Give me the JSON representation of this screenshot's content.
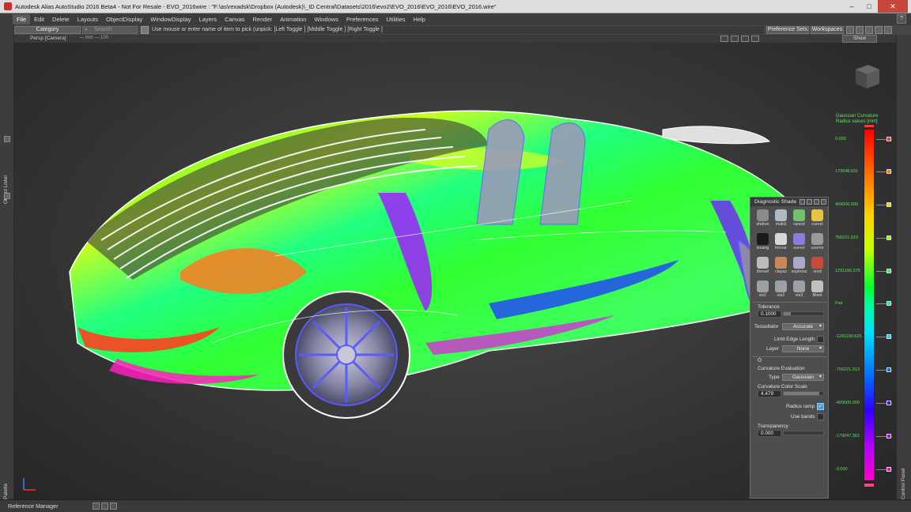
{
  "window": {
    "title": "Autodesk Alias AutoStudio 2016 Beta4 - Not For Resale  -  EVO_2016wire : \"F:\\as\\rexadsk\\Dropbox (Autodesk)\\_ID Central\\Datasets\\2016\\evo2\\EVO_2016\\EVO_2016\\EVO_2016.wire\"",
    "minimize": "–",
    "maximize": "□",
    "close": "✕"
  },
  "menu": [
    "File",
    "Edit",
    "Delete",
    "Layouts",
    "ObjectDisplay",
    "WindowDisplay",
    "Layers",
    "Canvas",
    "Render",
    "Animation",
    "Windows",
    "Preferences",
    "Utilities",
    "Help"
  ],
  "toolbar": {
    "category": "Category",
    "search_placeholder": "Search",
    "prompt": "Use mouse or enter name of item to pick (unpick: [Left Toggle ] [Middle Toggle ] [Right Toggle ]",
    "preference_sets": "Preference Sets",
    "workspaces": "Workspaces"
  },
  "viewport": {
    "camera": "Persp [Camera]",
    "ruler": "— mm  — 100",
    "show": "Show"
  },
  "left_rail": {
    "object_lister": "Object Lister",
    "palette": "Palette"
  },
  "right_rail": {
    "control_panel": "Control Panel"
  },
  "legend": {
    "title_line1": "Gaussian Curvature",
    "title_line2": "Radius values [mm]",
    "labels": [
      "0.000",
      "179048.831",
      "409000.000",
      "756221.013",
      "1291190.375",
      "Flat",
      "-1291190.625",
      "-756221.013",
      "-409000.000",
      "-179047.363",
      "-0.000"
    ]
  },
  "diag_panel": {
    "title": "Diagnostic Shade",
    "shaders": [
      {
        "label": "shdren",
        "color": "#8a8a8a"
      },
      {
        "label": "multcl",
        "color": "#b0b8c0"
      },
      {
        "label": "rancol",
        "color": "#6fc26a"
      },
      {
        "label": "curevl",
        "color": "#e2c640"
      },
      {
        "label": "isoang",
        "color": "#1a1a1a"
      },
      {
        "label": "horvar",
        "color": "#d8d8d8"
      },
      {
        "label": "surevl",
        "color": "#8a7de0"
      },
      {
        "label": "usemo",
        "color": "#9a9a9a"
      },
      {
        "label": "thinsel",
        "color": "#bcbcbc"
      },
      {
        "label": "clayaz",
        "color": "#c88858"
      },
      {
        "label": "sophoss",
        "color": "#a8a8c8"
      },
      {
        "label": "vred",
        "color": "#c84a3a"
      },
      {
        "label": "vis1",
        "color": "#9aa0a6"
      },
      {
        "label": "vis2",
        "color": "#9aa0a6"
      },
      {
        "label": "vis3",
        "color": "#9aa0a6"
      },
      {
        "label": "fillest",
        "color": "#c0c0c0"
      }
    ],
    "tolerance_label": "Tolerance",
    "tolerance_value": "0.1000",
    "tessellator_label": "Tessellator",
    "tessellator_value": "Accurate",
    "limit_edge_label": "Limit Edge Length",
    "layer_label": "Layer",
    "layer_value": "None",
    "curv_eval_label": "Curvature Evaluation",
    "type_label": "Type",
    "type_value": "Gaussian",
    "color_scale_label": "Curvature Color Scale",
    "color_scale_value": "4.479",
    "radius_ramp_label": "Radius ramp",
    "use_bands_label": "Use bands",
    "transparency_label": "Transparency",
    "transparency_value": "0.000"
  },
  "status": {
    "reference_manager": "Reference Manager"
  },
  "colors": {
    "legend_text": "#5fe05f",
    "checkbox_on": "#3ea0e0",
    "close_button": "#c7463b"
  }
}
